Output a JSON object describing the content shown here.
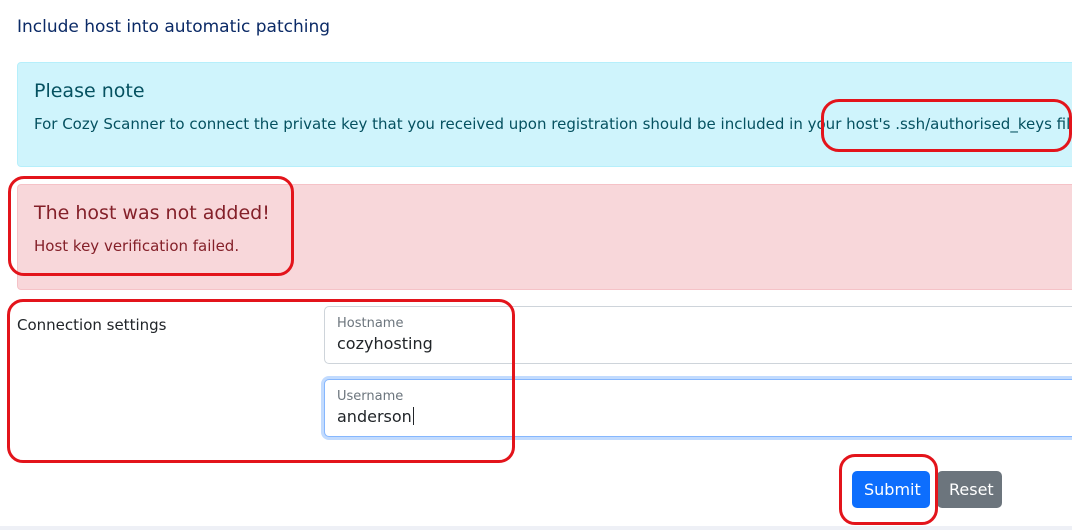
{
  "page": {
    "title": "Include host into automatic patching"
  },
  "info_alert": {
    "heading": "Please note",
    "text": "For Cozy Scanner to connect the private key that you received upon registration should be included in your host's .ssh/authorised_keys file."
  },
  "error_alert": {
    "heading": "The host was not added!",
    "text": "Host key verification failed."
  },
  "form": {
    "section_label": "Connection settings",
    "hostname": {
      "label": "Hostname",
      "value": "cozyhosting"
    },
    "username": {
      "label": "Username",
      "value": "anderson"
    },
    "submit_label": "Submit",
    "reset_label": "Reset"
  },
  "colors": {
    "title": "#0b2a66",
    "info_bg": "#cff4fc",
    "info_text": "#055160",
    "danger_bg": "#f8d7da",
    "danger_text": "#842029",
    "primary": "#0d6efd",
    "secondary": "#6c757d",
    "annotation": "#e3141b"
  }
}
